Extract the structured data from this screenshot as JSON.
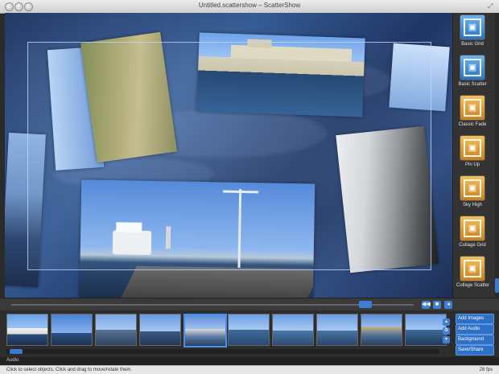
{
  "window": {
    "title": "Untitled.scattershow – ScatterShow"
  },
  "templates": [
    {
      "label": "Basic Grid",
      "style": "blue"
    },
    {
      "label": "Basic Scatter",
      "style": "blue"
    },
    {
      "label": "Classic Fade",
      "style": "orange"
    },
    {
      "label": "Pin Up",
      "style": "orange"
    },
    {
      "label": "Sky High",
      "style": "orange"
    },
    {
      "label": "Collage Grid",
      "style": "orange"
    },
    {
      "label": "Collage Scatter",
      "style": "orange"
    }
  ],
  "actions": {
    "add_images": "Add Images",
    "add_audio": "Add Audio",
    "background": "Background",
    "save_share": "Save/Share"
  },
  "filmstrip": {
    "count": 10,
    "selected_index": 4
  },
  "audio": {
    "label": "Audio"
  },
  "status": {
    "text": "Click to select objects. Click and drag to move/rotate them.",
    "fps": "28 fps"
  },
  "colors": {
    "accent": "#3d7fd6",
    "canvas_blue": "#345a92"
  }
}
